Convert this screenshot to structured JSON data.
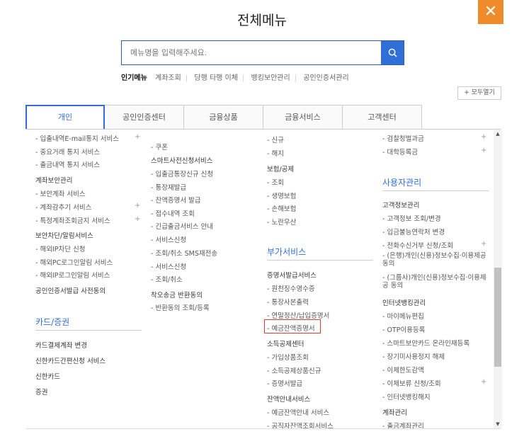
{
  "title": "전체메뉴",
  "close_label": "✕",
  "search": {
    "placeholder": "메뉴명을 입력해주세요."
  },
  "popular": {
    "label": "인기메뉴",
    "items": [
      "계좌조회",
      "당행 타행 이체",
      "뱅킹보안관리",
      "공인인증서관리"
    ]
  },
  "expand_all": "+ 모두열기",
  "tabs": [
    "개인",
    "공인인증센터",
    "금융상품",
    "금융서비스",
    "고객센터"
  ],
  "col1": {
    "items": [
      "입출내역E-mail통지 서비스",
      "중요거래 통지 서비스",
      "출금내역 통지 서비스",
      "계좌보안관리",
      "보안계좌 서비스",
      "계좌감추기 서비스",
      "특정계좌조회금지 서비스",
      "보안차단/알림서비스",
      "해외IP차단 신청",
      "해외PC로그인알림 서비스",
      "해외IP로그인알림 서비스",
      "공인인증서발급 사전동의"
    ],
    "section": "카드/증권",
    "section_items": [
      "카드결제계좌 변경",
      "신한카드간편신청 서비스",
      "신한카드",
      "증권"
    ]
  },
  "col2": {
    "items": [
      "쿠폰",
      "스마트사전신청서비스",
      "입출금통장신규 신청",
      "통장재발급",
      "잔액증명서 발급",
      "접수내역 조회",
      "긴급출금서비스 안내",
      "서비스신청",
      "조회/취소 SMS재전송",
      "서비스신청",
      "조회/취소",
      "착오송금 반환동의",
      "반환동의 조회/등록"
    ]
  },
  "col3": {
    "items": [
      "신규",
      "해지",
      "보험/공제",
      "조회",
      "생명보험",
      "손해보험",
      "노란우산"
    ],
    "section": "부가서비스",
    "section_items": [
      "증명서발급서비스",
      "원천징수영수증",
      "통장사본출력",
      "연말정산/납입증명서",
      "예금잔액증명서",
      "소득공제센터",
      "가입상품조회",
      "소득공제상품신규",
      "증명서발급",
      "잔액안내서비스",
      "예금잔액안내 서비스",
      "공직자잔액조회서비스"
    ]
  },
  "col4": {
    "items": [
      "검찰청벌과금",
      "대학등록금"
    ],
    "section": "사용자관리",
    "section_items": [
      "고객정보관리",
      "고객정보 조회/변경",
      "입금불능연락처 변경",
      "전화수신거부 신청/조회",
      "(은행)개인(신용)정보수집·이용제공 동의",
      "(그룹사)개인(신용)정보수집·이용제공 동의",
      "인터넷뱅킹관리",
      "마이메뉴편집",
      "OTP이용등록",
      "스마트보안카드 온라인재등록",
      "장기미사용정지 해제",
      "이체한도감액",
      "이체보류 신청/조회",
      "인터넷뱅킹해지",
      "계좌관리",
      "출금계좌관리"
    ]
  },
  "scroll_up": "▲",
  "scroll_down": "▼",
  "plus_sign": "+"
}
